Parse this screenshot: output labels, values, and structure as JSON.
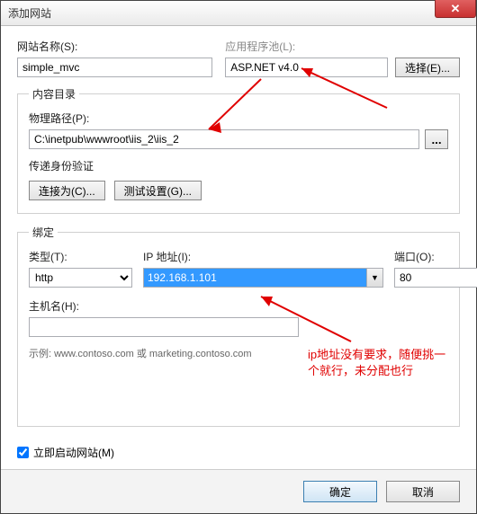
{
  "title": "添加网站",
  "labels": {
    "siteName": "网站名称(S):",
    "appPool": "应用程序池(L):",
    "select": "选择(E)...",
    "contentDir": "内容目录",
    "physicalPath": "物理路径(P):",
    "passAuth": "传递身份验证",
    "connectAs": "连接为(C)...",
    "testSettings": "测试设置(G)...",
    "binding": "绑定",
    "type": "类型(T):",
    "ip": "IP 地址(I):",
    "port": "端口(O):",
    "hostname": "主机名(H):",
    "example": "示例: www.contoso.com 或 marketing.contoso.com",
    "startNow": "立即启动网站(M)",
    "ok": "确定",
    "cancel": "取消"
  },
  "values": {
    "siteName": "simple_mvc",
    "appPool": "ASP.NET v4.0",
    "physicalPath": "C:\\inetpub\\wwwroot\\iis_2\\iis_2",
    "type": "http",
    "ip": "192.168.1.101",
    "port": "80",
    "hostname": "",
    "startNow": true
  },
  "annotations": {
    "note1": "ip地址没有要求，随便挑一个就行，未分配也行"
  }
}
